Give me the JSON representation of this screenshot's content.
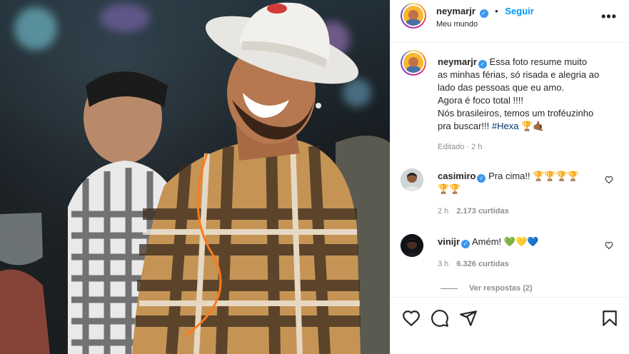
{
  "post": {
    "username": "neymarjr",
    "follow_label": "Seguir",
    "separator": "•",
    "location": "Meu mundo",
    "more_label": "•••"
  },
  "caption": {
    "username": "neymarjr",
    "lines": [
      "Essa foto resume muito",
      "as minhas férias, só risada e alegria ao",
      "lado das pessoas que eu amo.",
      "Agora é foco total !!!!",
      "Nós brasileiros, temos um troféuzinho",
      "pra buscar!!!"
    ],
    "hashtag": "#Hexa",
    "emoji": "🏆🤙🏾",
    "edited_label": "Editado",
    "time": "2 h"
  },
  "comments": [
    {
      "username": "casimiro",
      "text_line1": "Pra cima!! 🏆🏆🏆🏆",
      "text_line2": "🏆🏆",
      "time": "2 h",
      "likes": "2.173 curtidas"
    },
    {
      "username": "vinijr",
      "text_line1": "Amém! 💚💛💙",
      "time": "3 h",
      "likes": "6.326 curtidas",
      "replies_label": "Ver respostas (2)"
    }
  ],
  "colors": {
    "link_blue": "#0095f6",
    "verified_blue": "#3897f0",
    "muted_gray": "#8e8e8e"
  },
  "icons": [
    "heart-icon",
    "comment-icon",
    "share-icon",
    "bookmark-icon",
    "verified-icon",
    "more-icon"
  ]
}
